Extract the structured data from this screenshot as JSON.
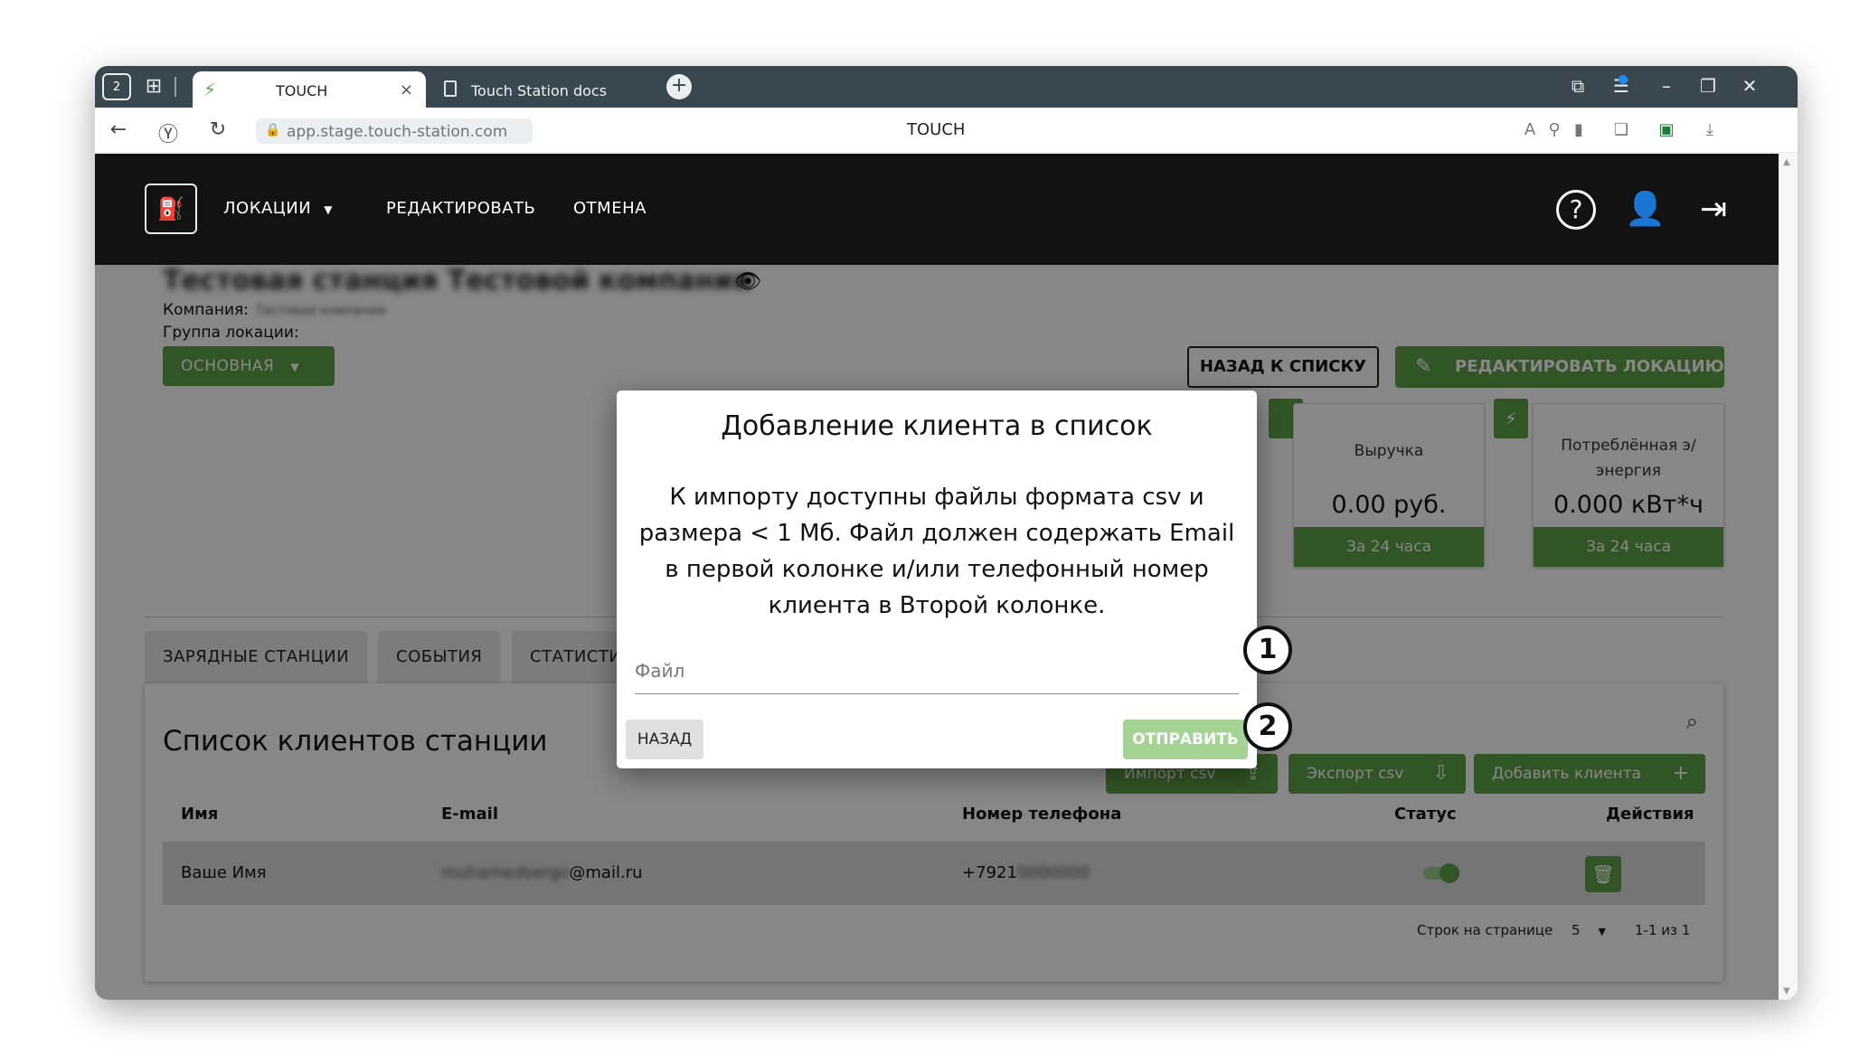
{
  "browser": {
    "home_tab_badge": "2",
    "active_tab_title": "TOUCH",
    "second_tab_title": "Touch Station docs",
    "url": "app.stage.touch-station.com",
    "page_title": "TOUCH",
    "new_tab_symbol": "+",
    "close_symbol": "×"
  },
  "app": {
    "nav": {
      "locations": "ЛОКАЦИИ",
      "edit": "РЕДАКТИРОВАТЬ",
      "cancel": "ОТМЕНА"
    },
    "station_title": "Тестовая станция Тестовой компании",
    "company_label": "Компания:",
    "company_value": "Тестовая компания",
    "group_label": "Группа локации:",
    "group_button": "ОСНОВНАЯ",
    "back_to_list": "НАЗАД К СПИСКУ",
    "edit_location": "РЕДАКТИРОВАТЬ ЛОКАЦИЮ",
    "cards": [
      {
        "label": "Выручка",
        "value": "0.00 руб.",
        "footer": "За 24 часа"
      },
      {
        "label": "Потреблённая э/ энергия",
        "value": "0.000 кВт*ч",
        "footer": "За 24 часа"
      }
    ],
    "tabs": [
      "ЗАРЯДНЫЕ СТАНЦИИ",
      "СОБЫТИЯ",
      "СТАТИСТИ"
    ],
    "clients": {
      "title": "Список клиентов станции",
      "import_btn": "Импорт csv",
      "export_btn": "Экспорт csv",
      "add_btn": "Добавить клиента",
      "columns": [
        "Имя",
        "E-mail",
        "Номер телефона",
        "Статус",
        "Действия"
      ],
      "rows": [
        {
          "name": "Ваше Имя",
          "email_hidden": "muhamedsergo",
          "email_domain": "@mail.ru",
          "phone_prefix": "+7921",
          "phone_hidden": "0000000"
        }
      ],
      "rows_per_page_label": "Строк на странице",
      "rows_per_page": "5",
      "range": "1-1 из 1"
    }
  },
  "dialog": {
    "title": "Добавление клиента в список",
    "text": "К импорту доступны файлы формата csv и размера < 1 Мб. Файл должен содержать Email в первой колонке и/или телефонный номер клиента в Второй колонке.",
    "file_placeholder": "Файл",
    "back": "НАЗАД",
    "send": "ОТПРАВИТЬ"
  },
  "callouts": [
    "1",
    "2"
  ],
  "colors": {
    "accent_green": "#5fa046",
    "disabled_green": "#a4d393",
    "topnav_bg": "#121212",
    "tabstrip_bg": "#39474f"
  }
}
